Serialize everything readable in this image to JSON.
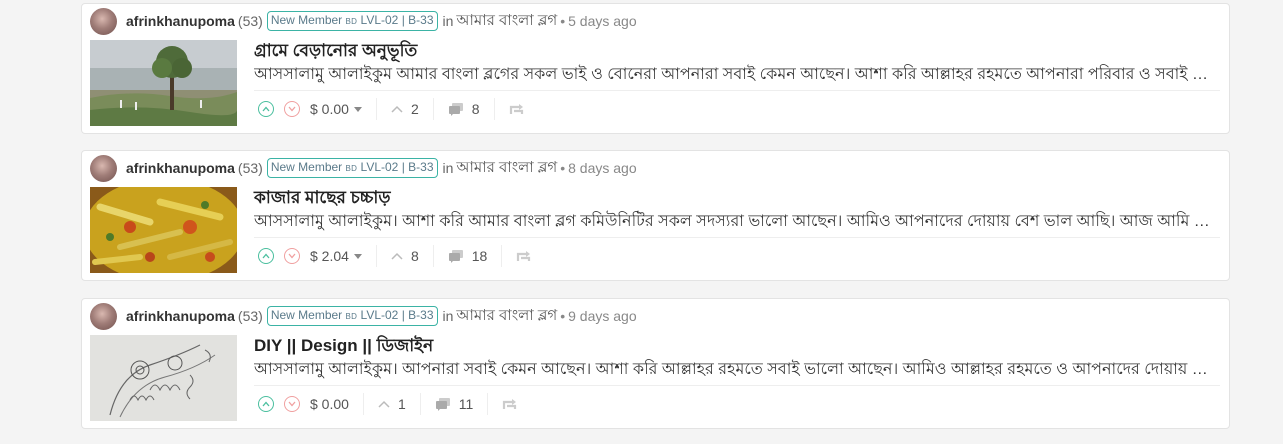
{
  "colors": {
    "upvote": "#4bbf9f",
    "downvote": "#f0a0a0",
    "badge_border": "#3bb3a5"
  },
  "posts": [
    {
      "author": "afrinkhanupoma",
      "reputation": "(53)",
      "badge_prefix": "New Member ",
      "badge_small": "BD",
      "badge_suffix": " LVL-02 | B-33",
      "in_word": "in",
      "community": "আমার বাংলা ব্লগ",
      "bullet": "•",
      "time": "5 days ago",
      "title": "গ্রামে বেড়ানোর অনুভূতি",
      "excerpt": "আসসালামু আলাইকুম আমার বাংলা ব্লগের সকল ভাই ও বোনেরা আপনারা সবাই কেমন আছেন। আশা করি আল্লাহর রহমতে আপনারা পরিবার ও সবাই ভালো আছেন।",
      "payout": "$ 0.00",
      "votes": "2",
      "replies": "8",
      "thumbnail_icon": "beach-tree-photo"
    },
    {
      "author": "afrinkhanupoma",
      "reputation": "(53)",
      "badge_prefix": "New Member ",
      "badge_small": "BD",
      "badge_suffix": " LVL-02 | B-33",
      "in_word": "in",
      "community": "আমার বাংলা ব্লগ",
      "bullet": "•",
      "time": "8 days ago",
      "title": "কাজার মাছের চচ্চাড়",
      "excerpt": "আসসালামু আলাইকুম। আশা করি আমার বাংলা ব্লগ কমিউনিটির সকল সদস্যরা ভালো আছেন। আমিও আপনাদের দোয়ায় বেশ ভাল আছি। আজ আমি আপনাদের সাথে শেয়ার করব।",
      "payout": "$ 2.04",
      "votes": "8",
      "replies": "18",
      "thumbnail_icon": "fish-curry-photo"
    },
    {
      "author": "afrinkhanupoma",
      "reputation": "(53)",
      "badge_prefix": "New Member ",
      "badge_small": "BD",
      "badge_suffix": " LVL-02 | B-33",
      "in_word": "in",
      "community": "আমার বাংলা ব্লগ",
      "bullet": "•",
      "time": "9 days ago",
      "title": "DIY || Design || ডিজাইন",
      "excerpt": "আসসালামু আলাইকুম। আপনারা সবাই কেমন আছেন। আশা করি আল্লাহর রহমতে সবাই ভালো আছেন। আমিও আল্লাহর রহমতে ও আপনাদের দোয়ায় ভালো আছি।",
      "payout": "$ 0.00",
      "votes": "1",
      "replies": "11",
      "thumbnail_icon": "mehndi-design-drawing-photo"
    }
  ]
}
